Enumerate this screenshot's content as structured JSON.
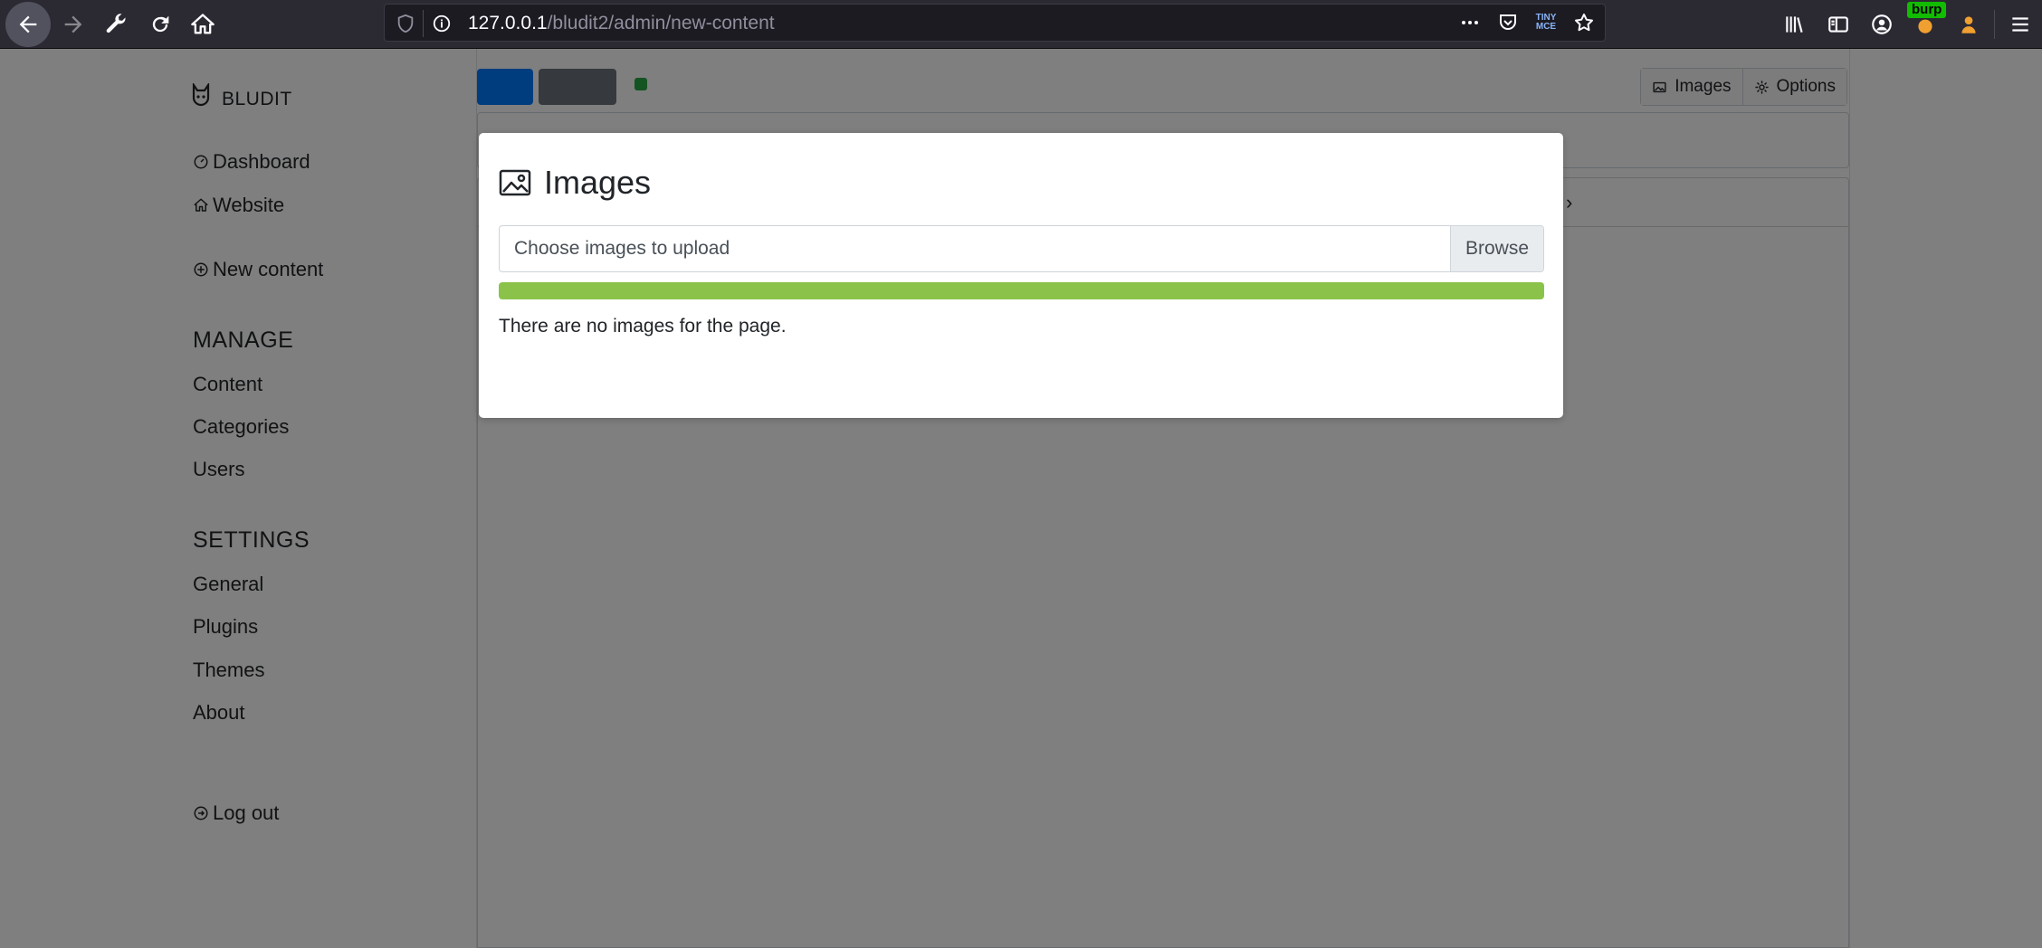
{
  "browser": {
    "url_host": "127.0.0.1",
    "url_path": "/bludit2/admin/new-content",
    "burp_badge": "burp",
    "colors": {
      "chrome_bg": "#2b2a33",
      "urlbar_bg": "#1c1b22"
    }
  },
  "sidebar": {
    "brand": "BLUDIT",
    "dashboard": "Dashboard",
    "website": "Website",
    "new_content": "New content",
    "manage_heading": "MANAGE",
    "content": "Content",
    "categories": "Categories",
    "users": "Users",
    "settings_heading": "SETTINGS",
    "general": "General",
    "plugins": "Plugins",
    "themes": "Themes",
    "about": "About",
    "logout": "Log out"
  },
  "editor": {
    "images_button": "Images",
    "options_button": "Options"
  },
  "modal": {
    "title": "Images",
    "file_placeholder": "Choose images to upload",
    "browse_label": "Browse",
    "progress_fraction": 1.0,
    "progress_color": "#8bc34a",
    "empty_message": "There are no images for the page."
  }
}
